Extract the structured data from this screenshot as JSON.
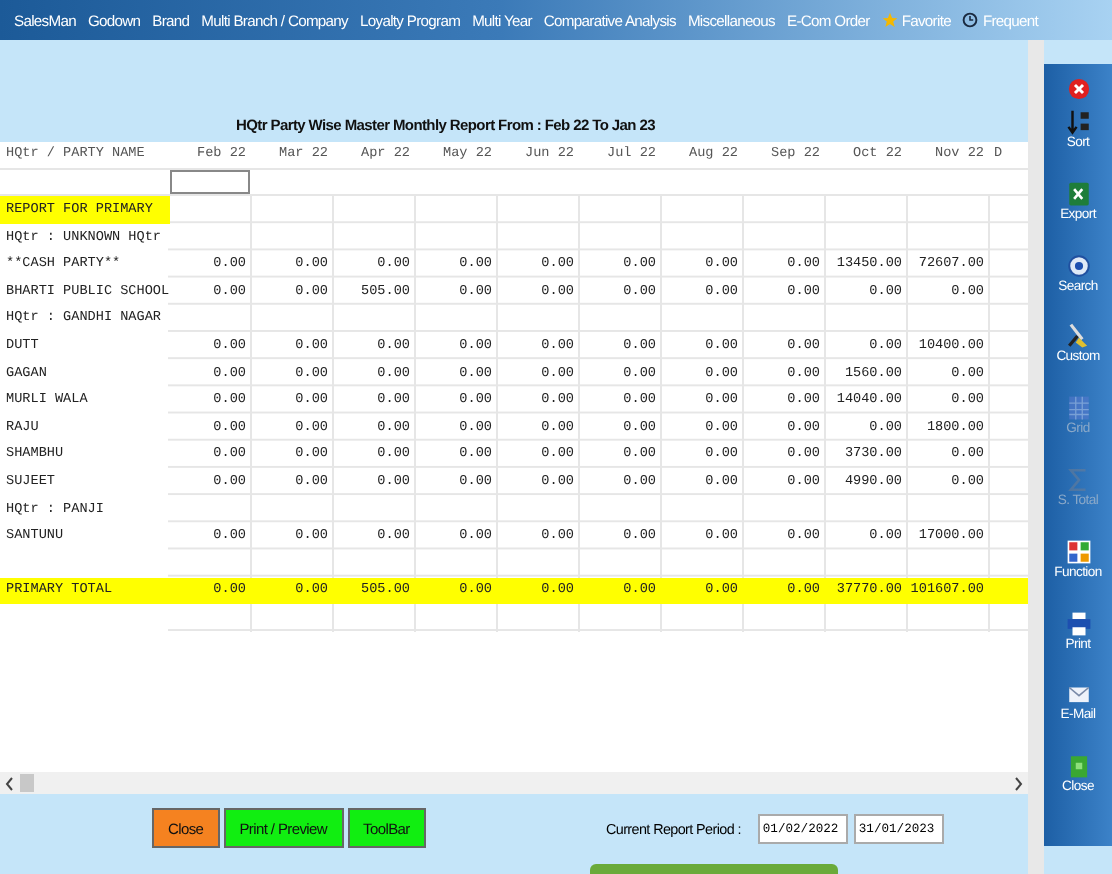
{
  "menu": {
    "items": [
      "SalesMan",
      "Godown",
      "Brand",
      "Multi Branch / Company",
      "Loyalty Program",
      "Multi Year",
      "Comparative Analysis",
      "Miscellaneous",
      "E-Com Order"
    ],
    "favorite": "Favorite",
    "frequent": "Frequent"
  },
  "report_title": "HQtr Party Wise Master Monthly Report From : Feb 22 To Jan 23",
  "table": {
    "columns": [
      "HQtr / PARTY NAME",
      "Feb 22",
      "Mar 22",
      "Apr 22",
      "May 22",
      "Jun 22",
      "Jul 22",
      "Aug 22",
      "Sep 22",
      "Oct 22",
      "Nov 22",
      "D"
    ],
    "rows": [
      {
        "kind": "section",
        "name": "REPORT FOR PRIMARY"
      },
      {
        "kind": "group",
        "name": "HQtr : UNKNOWN HQtr"
      },
      {
        "kind": "party",
        "name": "**CASH PARTY**",
        "values": [
          "0.00",
          "0.00",
          "0.00",
          "0.00",
          "0.00",
          "0.00",
          "0.00",
          "0.00",
          "13450.00",
          "72607.00"
        ]
      },
      {
        "kind": "party",
        "name": "BHARTI PUBLIC SCHOOL",
        "values": [
          "0.00",
          "0.00",
          "505.00",
          "0.00",
          "0.00",
          "0.00",
          "0.00",
          "0.00",
          "0.00",
          "0.00"
        ]
      },
      {
        "kind": "group",
        "name": "HQtr : GANDHI NAGAR"
      },
      {
        "kind": "party",
        "name": "DUTT",
        "values": [
          "0.00",
          "0.00",
          "0.00",
          "0.00",
          "0.00",
          "0.00",
          "0.00",
          "0.00",
          "0.00",
          "10400.00"
        ]
      },
      {
        "kind": "party",
        "name": "GAGAN",
        "values": [
          "0.00",
          "0.00",
          "0.00",
          "0.00",
          "0.00",
          "0.00",
          "0.00",
          "0.00",
          "1560.00",
          "0.00"
        ]
      },
      {
        "kind": "party",
        "name": "MURLI WALA",
        "values": [
          "0.00",
          "0.00",
          "0.00",
          "0.00",
          "0.00",
          "0.00",
          "0.00",
          "0.00",
          "14040.00",
          "0.00"
        ]
      },
      {
        "kind": "party",
        "name": "RAJU",
        "values": [
          "0.00",
          "0.00",
          "0.00",
          "0.00",
          "0.00",
          "0.00",
          "0.00",
          "0.00",
          "0.00",
          "1800.00"
        ]
      },
      {
        "kind": "party",
        "name": "SHAMBHU",
        "values": [
          "0.00",
          "0.00",
          "0.00",
          "0.00",
          "0.00",
          "0.00",
          "0.00",
          "0.00",
          "3730.00",
          "0.00"
        ]
      },
      {
        "kind": "party",
        "name": "SUJEET",
        "values": [
          "0.00",
          "0.00",
          "0.00",
          "0.00",
          "0.00",
          "0.00",
          "0.00",
          "0.00",
          "4990.00",
          "0.00"
        ]
      },
      {
        "kind": "group",
        "name": "HQtr : PANJI"
      },
      {
        "kind": "party",
        "name": "SANTUNU",
        "values": [
          "0.00",
          "0.00",
          "0.00",
          "0.00",
          "0.00",
          "0.00",
          "0.00",
          "0.00",
          "0.00",
          "17000.00"
        ]
      },
      {
        "kind": "blank"
      },
      {
        "kind": "total",
        "name": "PRIMARY TOTAL",
        "values": [
          "0.00",
          "0.00",
          "505.00",
          "0.00",
          "0.00",
          "0.00",
          "0.00",
          "0.00",
          "37770.00",
          "101607.00"
        ]
      },
      {
        "kind": "blank"
      }
    ]
  },
  "buttons": [
    {
      "label": "Close",
      "kind": "orange"
    },
    {
      "label": "Print / Preview",
      "kind": "green"
    },
    {
      "label": "ToolBar",
      "kind": "green"
    }
  ],
  "period": {
    "label": "Current Report Period :",
    "from": "01/02/2022",
    "to": "31/01/2023"
  },
  "toolbar": [
    {
      "label": "Sort",
      "disabled": false
    },
    {
      "label": "Export",
      "disabled": false
    },
    {
      "label": "Search",
      "disabled": false
    },
    {
      "label": "Custom",
      "disabled": false
    },
    {
      "label": "Grid",
      "disabled": true
    },
    {
      "label": "S. Total",
      "disabled": true
    },
    {
      "label": "Function",
      "disabled": false
    },
    {
      "label": "Print",
      "disabled": false
    },
    {
      "label": "E-Mail",
      "disabled": false
    },
    {
      "label": "Close",
      "disabled": false
    }
  ]
}
